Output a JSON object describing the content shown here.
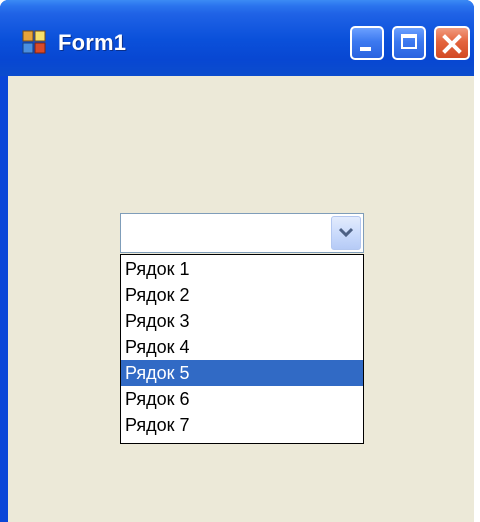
{
  "window": {
    "title": "Form1"
  },
  "combo": {
    "value": "",
    "items": [
      "Рядок 1",
      "Рядок 2",
      "Рядок 3",
      "Рядок 4",
      "Рядок 5",
      "Рядок 6",
      "Рядок 7"
    ],
    "selected_item": "Рядок 5"
  },
  "colors": {
    "titlebar": "#0a50da",
    "client_background": "#ece9d8",
    "selection_highlight": "#316ac5",
    "close_button": "#e4653e"
  },
  "icons": {
    "app": "form-app-icon",
    "minimize": "minimize-icon",
    "maximize": "maximize-icon",
    "close": "close-icon",
    "dropdown": "chevron-down-icon"
  }
}
